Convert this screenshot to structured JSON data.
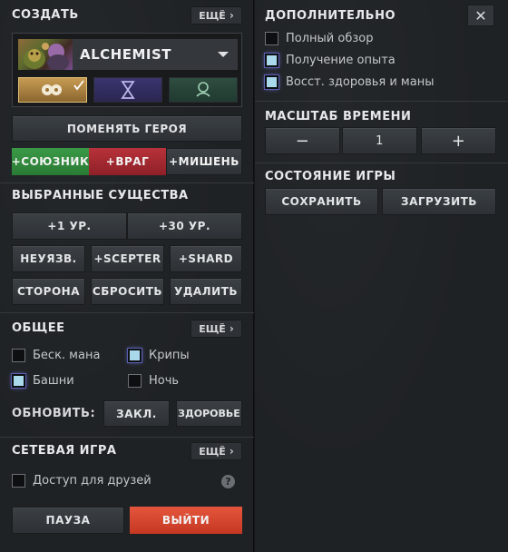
{
  "create": {
    "title": "СОЗДАТЬ",
    "more_label": "ЕЩЁ",
    "hero_name": "ALCHEMIST",
    "attributes": [
      "strength-icon",
      "agility-icon",
      "intelligence-icon"
    ],
    "swap_hero_label": "ПОМЕНЯТЬ ГЕРОЯ",
    "add_ally_label": "+СОЮЗНИК",
    "add_enemy_label": "+ВРАГ",
    "add_target_label": "+МИШЕНЬ",
    "colors": {
      "ally": "#2f8a3b",
      "enemy": "#a8282e",
      "target": "#393e43"
    }
  },
  "selected_units": {
    "title": "ВЫБРАННЫЕ СУЩЕСТВА",
    "level_up_1": "+1 УР.",
    "level_up_30": "+30 УР.",
    "invulnerable": "НЕУЯЗВ.",
    "scepter": "+SCEPTER",
    "shard": "+SHARD",
    "side": "СТОРОНА",
    "reset": "СБРОСИТЬ",
    "delete": "УДАЛИТЬ"
  },
  "general": {
    "title": "ОБЩЕЕ",
    "more_label": "ЕЩЁ",
    "infinite_mana": {
      "label": "Беск. мана",
      "checked": false
    },
    "creeps": {
      "label": "Крипы",
      "checked": true
    },
    "towers": {
      "label": "Башни",
      "checked": true
    },
    "night": {
      "label": "Ночь",
      "checked": false
    },
    "refresh_label": "ОБНОВИТЬ:",
    "cooldowns_label": "ЗАКЛ.",
    "health_label": "ЗДОРОВЬЕ"
  },
  "network": {
    "title": "СЕТЕВАЯ ИГРА",
    "more_label": "ЕЩЁ",
    "friends_access": {
      "label": "Доступ для друзей",
      "checked": false
    },
    "help_glyph": "?"
  },
  "footer": {
    "pause_label": "ПАУЗА",
    "exit_label": "ВЫЙТИ",
    "exit_color": "#d8452f"
  },
  "additional": {
    "title": "ДОПОЛНИТЕЛЬНО",
    "close_glyph": "✕",
    "full_vision": {
      "label": "Полный обзор",
      "checked": false
    },
    "gain_experience": {
      "label": "Получение опыта",
      "checked": true
    },
    "regen": {
      "label": "Восст. здоровья и маны",
      "checked": true
    }
  },
  "timescale": {
    "title": "МАСШТАБ ВРЕМЕНИ",
    "minus": "−",
    "value": "1",
    "plus": "+"
  },
  "game_state": {
    "title": "СОСТОЯНИЕ ИГРЫ",
    "save_label": "СОХРАНИТЬ",
    "load_label": "ЗАГРУЗИТЬ"
  }
}
